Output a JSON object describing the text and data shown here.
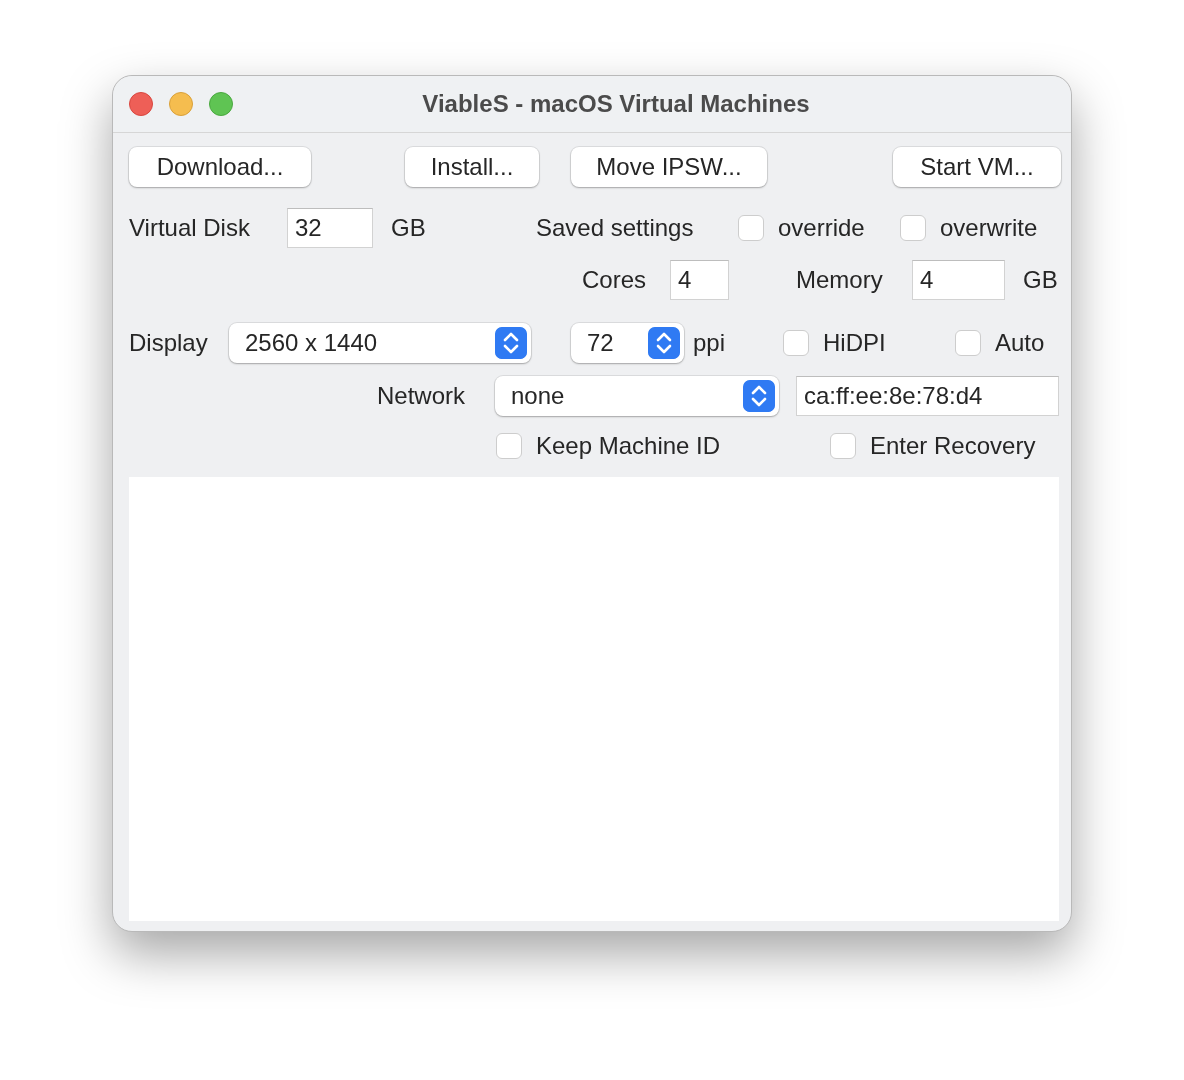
{
  "window": {
    "title": "ViableS - macOS Virtual Machines"
  },
  "toolbar": {
    "buttons": [
      "Download...",
      "Install...",
      "Move IPSW...",
      "Start VM..."
    ]
  },
  "rows": [
    [
      {
        "kind": "label",
        "text": "Virtual Disk"
      },
      {
        "kind": "field",
        "value": "32"
      },
      {
        "kind": "label",
        "text": "GB"
      },
      {
        "kind": "label",
        "text": "Saved settings"
      },
      {
        "kind": "checkbox",
        "label": "override",
        "checked": false
      },
      {
        "kind": "checkbox",
        "label": "overwrite",
        "checked": false
      }
    ],
    [
      {
        "kind": "label",
        "text": "Cores"
      },
      {
        "kind": "field",
        "value": "4"
      },
      {
        "kind": "label",
        "text": "Memory"
      },
      {
        "kind": "field",
        "value": "4"
      },
      {
        "kind": "label",
        "text": "GB"
      }
    ],
    [
      {
        "kind": "label",
        "text": "Display"
      },
      {
        "kind": "select",
        "value": "2560 x 1440"
      },
      {
        "kind": "select",
        "value": "72"
      },
      {
        "kind": "label",
        "text": "ppi"
      },
      {
        "kind": "checkbox",
        "label": "HiDPI",
        "checked": false
      },
      {
        "kind": "checkbox",
        "label": "Auto",
        "checked": false
      }
    ],
    [
      {
        "kind": "label",
        "text": "Network"
      },
      {
        "kind": "select",
        "value": "none"
      },
      {
        "kind": "field",
        "value": "ca:ff:ee:8e:78:d4"
      }
    ],
    [
      {
        "kind": "checkbox",
        "label": "Keep Machine ID",
        "checked": false
      },
      {
        "kind": "checkbox",
        "label": "Enter Recovery",
        "checked": false
      }
    ]
  ]
}
